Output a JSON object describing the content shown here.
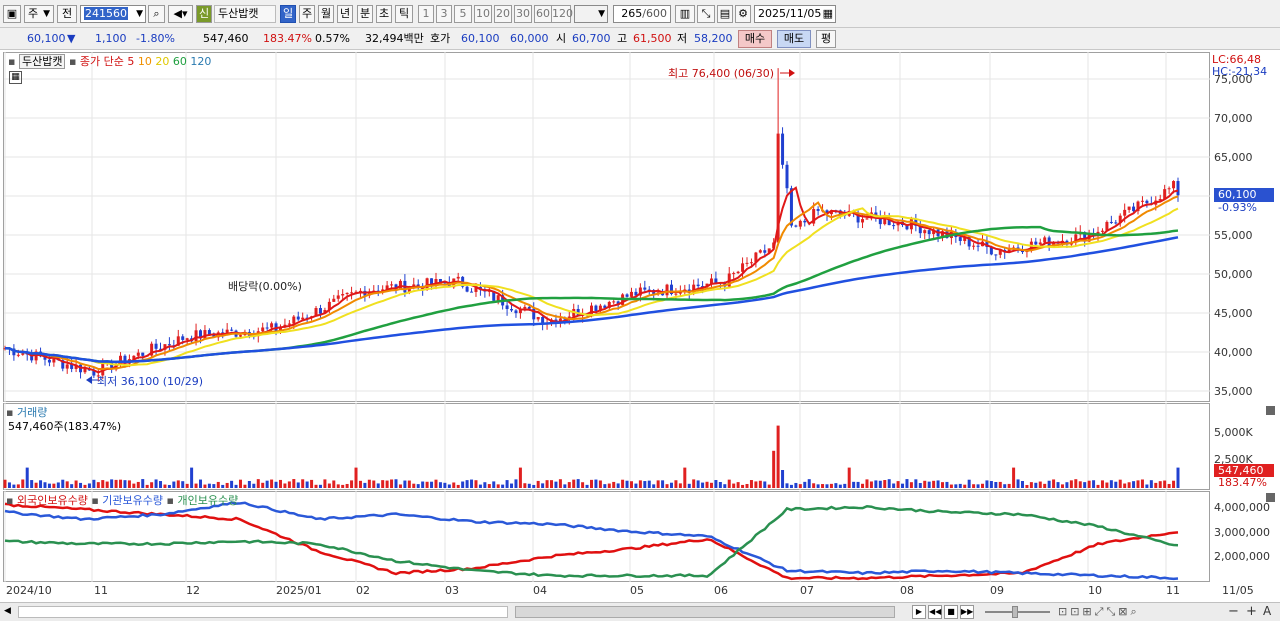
{
  "toolbar": {
    "market": "주",
    "period_prefix": "전",
    "code": "241560",
    "badge": "신",
    "stock_name": "두산밥캣",
    "tabs": [
      "일",
      "주",
      "월",
      "년",
      "분",
      "초",
      "틱"
    ],
    "intervals": [
      "1",
      "3",
      "5",
      "10",
      "20",
      "30",
      "60",
      "120"
    ],
    "count": "265",
    "count_max": "/600",
    "date": "2025/11/05"
  },
  "quote": {
    "price": "60,100",
    "arrow": "▼",
    "change": "1,100",
    "pct": "-1.80%",
    "volume": "547,460",
    "vol_ratio": "183.47%",
    "turnover": "0.57%",
    "amount": "32,494백만",
    "ask_label": "호가",
    "ask": "60,100",
    "bid": "60,000",
    "open_label": "시",
    "open": "60,700",
    "high_label": "고",
    "high": "61,500",
    "low_label": "저",
    "low": "58,200",
    "buy": "매수",
    "sell": "매도",
    "eval": "평"
  },
  "main_chart": {
    "name": "두산밥캣",
    "indicator": "종가 단순",
    "ma": [
      "5",
      "10",
      "20",
      "60",
      "120"
    ],
    "lc": "LC:66,48",
    "hc": "HC:-21,34",
    "yticks": [
      "75,000",
      "70,000",
      "65,000",
      "60,000",
      "55,000",
      "50,000",
      "45,000",
      "40,000",
      "35,000"
    ],
    "high_note": "최고 76,400 (06/30)",
    "low_note": "최저 36,100 (10/29)",
    "div_note": "배당락(0.00%)",
    "last_price": "60,100",
    "last_pct": "-0.93%"
  },
  "volume_chart": {
    "title": "거래량",
    "summary": "547,460주(183.47%)",
    "yticks": [
      "5,000K",
      "2,500K"
    ],
    "last": "547,460",
    "last_pct": "183.47%"
  },
  "holding_chart": {
    "legend": [
      "외국인보유수량",
      "기관보유수량",
      "개인보유수량"
    ],
    "yticks": [
      "4,000,000",
      "3,000,000",
      "2,000,000"
    ]
  },
  "xaxis": [
    "2024/10",
    "11",
    "12",
    "2025/01",
    "02",
    "03",
    "04",
    "05",
    "06",
    "07",
    "08",
    "09",
    "10",
    "11",
    "11/05"
  ],
  "colors": {
    "up": "#e02020",
    "down": "#2040d0",
    "ma5": "#e01818",
    "ma10": "#f08a00",
    "ma20": "#f0e020",
    "ma60": "#20a040",
    "ma120": "#2050e0",
    "foreign": "#e01010",
    "inst": "#2a58d8",
    "indiv": "#2a9050"
  },
  "chart_data": {
    "type": "candlestick",
    "price_range": [
      33000,
      77000
    ],
    "keypoints": {
      "x": [
        "2024/10",
        "11",
        "12",
        "2025/01",
        "02",
        "03",
        "04",
        "05",
        "06",
        "07",
        "08",
        "09",
        "10",
        "11"
      ],
      "close": [
        40500,
        37500,
        42000,
        43000,
        48000,
        49000,
        44000,
        47500,
        49000,
        58000,
        56500,
        53000,
        55000,
        61500
      ]
    },
    "high": 76400,
    "low": 36100,
    "last": 60100
  }
}
